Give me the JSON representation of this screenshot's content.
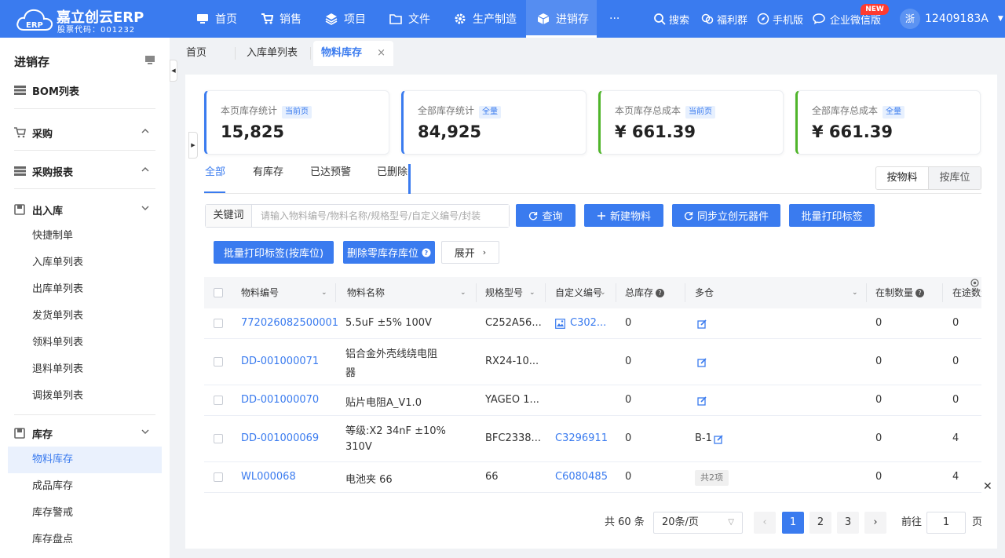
{
  "brand": {
    "name": "嘉立创云ERP",
    "stock_code": "股票代码：001232"
  },
  "nav": [
    {
      "label": "首页",
      "icon": "monitor-icon"
    },
    {
      "label": "销售",
      "icon": "cart-icon"
    },
    {
      "label": "项目",
      "icon": "layers-icon"
    },
    {
      "label": "文件",
      "icon": "folder-icon"
    },
    {
      "label": "生产制造",
      "icon": "gear-icon"
    },
    {
      "label": "进销存",
      "icon": "box-icon",
      "active": true
    },
    {
      "label": "···"
    }
  ],
  "right_nav": {
    "search": "搜索",
    "benefit": "福利群",
    "mobile": "手机版",
    "wechat": "企业微信版",
    "new_badge": "NEW"
  },
  "user": {
    "avatar": "浙",
    "name": "12409183A"
  },
  "sidebar": {
    "title": "进销存",
    "groups": [
      {
        "label": "BOM列表"
      },
      {
        "label": "采购"
      },
      {
        "label": "采购报表"
      },
      {
        "label": "出入库",
        "items": [
          "快捷制单",
          "入库单列表",
          "出库单列表",
          "发货单列表",
          "领料单列表",
          "退料单列表",
          "调拨单列表"
        ]
      },
      {
        "label": "库存",
        "items": [
          "物料库存",
          "成品库存",
          "库存警戒",
          "库存盘点"
        ]
      }
    ]
  },
  "page_tabs": [
    "首页",
    "入库单列表",
    "物料库存"
  ],
  "cards": [
    {
      "label": "本页库存统计",
      "tag": "当前页",
      "value": "15,825",
      "color": "#3a7bef"
    },
    {
      "label": "全部库存统计",
      "tag": "全量",
      "value": "84,925",
      "color": "#3a7bef"
    },
    {
      "label": "本页库存总成本",
      "tag": "当前页",
      "value": "¥ 661.39",
      "color": "#4fb52a"
    },
    {
      "label": "全部库存总成本",
      "tag": "全量",
      "value": "¥ 661.39",
      "color": "#4fb52a"
    }
  ],
  "filter_tabs": [
    "全部",
    "有库存",
    "已达预警",
    "已删除"
  ],
  "view_toggle": {
    "by_material": "按物料",
    "by_location": "按库位"
  },
  "search": {
    "label": "关键词",
    "placeholder": "请输入物料编号/物料名称/规格型号/自定义编号/封装"
  },
  "buttons": {
    "query": "查询",
    "new_material": "新建物料",
    "sync": "同步立创元器件",
    "batch_print": "批量打印标签",
    "batch_print_loc": "批量打印标签(按库位)",
    "delete_zero": "删除零库存库位",
    "expand": "展开"
  },
  "table": {
    "columns": [
      "物料编号",
      "物料名称",
      "规格型号",
      "自定义编号",
      "总库存",
      "多仓",
      "在制数量",
      "在途数量"
    ],
    "rows": [
      {
        "code": "772026082500001",
        "name": [
          "5.5uF ±5% 100V"
        ],
        "spec": "C252A56...",
        "custom": "C302...",
        "custom_img": true,
        "total": "0",
        "multi": "",
        "making": "0",
        "transit": "0"
      },
      {
        "code": "DD-001000071",
        "name": [
          "铝合金外壳线绕电阻",
          "器"
        ],
        "spec": "RX24-10...",
        "custom": "",
        "total": "0",
        "multi": "",
        "making": "0",
        "transit": "0"
      },
      {
        "code": "DD-001000070",
        "name": [
          "贴片电阻A_V1.0"
        ],
        "spec": "YAGEO 1...",
        "custom": "",
        "total": "0",
        "multi": "",
        "making": "0",
        "transit": "0"
      },
      {
        "code": "DD-001000069",
        "name": [
          "等级:X2 34nF ±10%",
          "310V"
        ],
        "spec": "BFC2338...",
        "custom": "C3296911",
        "total": "0",
        "multi": "B-1",
        "making": "0",
        "transit": "4"
      },
      {
        "code": "WL000068",
        "name": [
          "电池夹 66"
        ],
        "spec": "66",
        "custom": "C6080485",
        "total": "0",
        "multi_pill": "共2项",
        "making": "0",
        "transit": "4"
      }
    ]
  },
  "pagination": {
    "total": "共 60 条",
    "per_page": "20条/页",
    "pages": [
      "1",
      "2",
      "3"
    ],
    "current": "1",
    "goto_label": "前往",
    "goto_value": "1",
    "goto_suffix": "页"
  }
}
